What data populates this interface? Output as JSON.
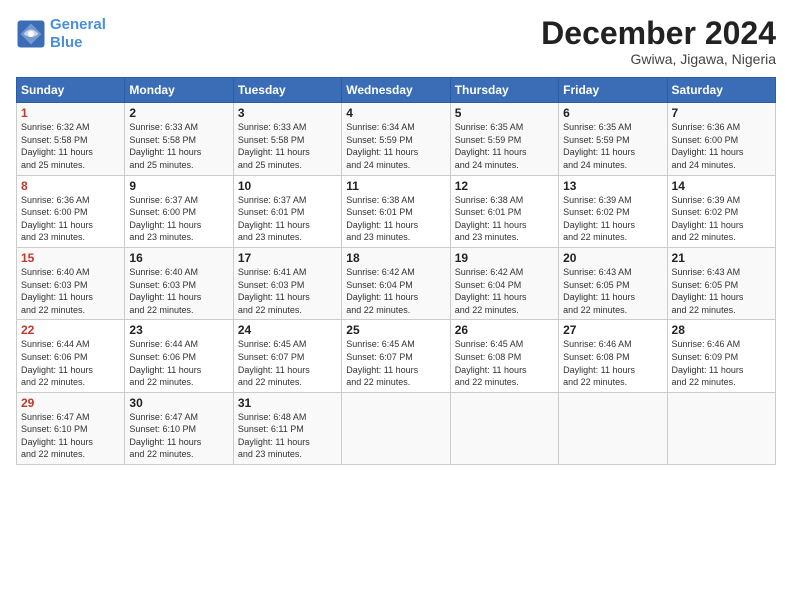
{
  "logo": {
    "line1": "General",
    "line2": "Blue"
  },
  "title": "December 2024",
  "location": "Gwiwa, Jigawa, Nigeria",
  "weekdays": [
    "Sunday",
    "Monday",
    "Tuesday",
    "Wednesday",
    "Thursday",
    "Friday",
    "Saturday"
  ],
  "weeks": [
    [
      {
        "day": "1",
        "sunrise": "6:32 AM",
        "sunset": "5:58 PM",
        "daylight": "11 hours and 25 minutes."
      },
      {
        "day": "2",
        "sunrise": "6:33 AM",
        "sunset": "5:58 PM",
        "daylight": "11 hours and 25 minutes."
      },
      {
        "day": "3",
        "sunrise": "6:33 AM",
        "sunset": "5:58 PM",
        "daylight": "11 hours and 25 minutes."
      },
      {
        "day": "4",
        "sunrise": "6:34 AM",
        "sunset": "5:59 PM",
        "daylight": "11 hours and 24 minutes."
      },
      {
        "day": "5",
        "sunrise": "6:35 AM",
        "sunset": "5:59 PM",
        "daylight": "11 hours and 24 minutes."
      },
      {
        "day": "6",
        "sunrise": "6:35 AM",
        "sunset": "5:59 PM",
        "daylight": "11 hours and 24 minutes."
      },
      {
        "day": "7",
        "sunrise": "6:36 AM",
        "sunset": "6:00 PM",
        "daylight": "11 hours and 24 minutes."
      }
    ],
    [
      {
        "day": "8",
        "sunrise": "6:36 AM",
        "sunset": "6:00 PM",
        "daylight": "11 hours and 23 minutes."
      },
      {
        "day": "9",
        "sunrise": "6:37 AM",
        "sunset": "6:00 PM",
        "daylight": "11 hours and 23 minutes."
      },
      {
        "day": "10",
        "sunrise": "6:37 AM",
        "sunset": "6:01 PM",
        "daylight": "11 hours and 23 minutes."
      },
      {
        "day": "11",
        "sunrise": "6:38 AM",
        "sunset": "6:01 PM",
        "daylight": "11 hours and 23 minutes."
      },
      {
        "day": "12",
        "sunrise": "6:38 AM",
        "sunset": "6:01 PM",
        "daylight": "11 hours and 23 minutes."
      },
      {
        "day": "13",
        "sunrise": "6:39 AM",
        "sunset": "6:02 PM",
        "daylight": "11 hours and 22 minutes."
      },
      {
        "day": "14",
        "sunrise": "6:39 AM",
        "sunset": "6:02 PM",
        "daylight": "11 hours and 22 minutes."
      }
    ],
    [
      {
        "day": "15",
        "sunrise": "6:40 AM",
        "sunset": "6:03 PM",
        "daylight": "11 hours and 22 minutes."
      },
      {
        "day": "16",
        "sunrise": "6:40 AM",
        "sunset": "6:03 PM",
        "daylight": "11 hours and 22 minutes."
      },
      {
        "day": "17",
        "sunrise": "6:41 AM",
        "sunset": "6:03 PM",
        "daylight": "11 hours and 22 minutes."
      },
      {
        "day": "18",
        "sunrise": "6:42 AM",
        "sunset": "6:04 PM",
        "daylight": "11 hours and 22 minutes."
      },
      {
        "day": "19",
        "sunrise": "6:42 AM",
        "sunset": "6:04 PM",
        "daylight": "11 hours and 22 minutes."
      },
      {
        "day": "20",
        "sunrise": "6:43 AM",
        "sunset": "6:05 PM",
        "daylight": "11 hours and 22 minutes."
      },
      {
        "day": "21",
        "sunrise": "6:43 AM",
        "sunset": "6:05 PM",
        "daylight": "11 hours and 22 minutes."
      }
    ],
    [
      {
        "day": "22",
        "sunrise": "6:44 AM",
        "sunset": "6:06 PM",
        "daylight": "11 hours and 22 minutes."
      },
      {
        "day": "23",
        "sunrise": "6:44 AM",
        "sunset": "6:06 PM",
        "daylight": "11 hours and 22 minutes."
      },
      {
        "day": "24",
        "sunrise": "6:45 AM",
        "sunset": "6:07 PM",
        "daylight": "11 hours and 22 minutes."
      },
      {
        "day": "25",
        "sunrise": "6:45 AM",
        "sunset": "6:07 PM",
        "daylight": "11 hours and 22 minutes."
      },
      {
        "day": "26",
        "sunrise": "6:45 AM",
        "sunset": "6:08 PM",
        "daylight": "11 hours and 22 minutes."
      },
      {
        "day": "27",
        "sunrise": "6:46 AM",
        "sunset": "6:08 PM",
        "daylight": "11 hours and 22 minutes."
      },
      {
        "day": "28",
        "sunrise": "6:46 AM",
        "sunset": "6:09 PM",
        "daylight": "11 hours and 22 minutes."
      }
    ],
    [
      {
        "day": "29",
        "sunrise": "6:47 AM",
        "sunset": "6:10 PM",
        "daylight": "11 hours and 22 minutes."
      },
      {
        "day": "30",
        "sunrise": "6:47 AM",
        "sunset": "6:10 PM",
        "daylight": "11 hours and 22 minutes."
      },
      {
        "day": "31",
        "sunrise": "6:48 AM",
        "sunset": "6:11 PM",
        "daylight": "11 hours and 23 minutes."
      },
      null,
      null,
      null,
      null
    ]
  ]
}
